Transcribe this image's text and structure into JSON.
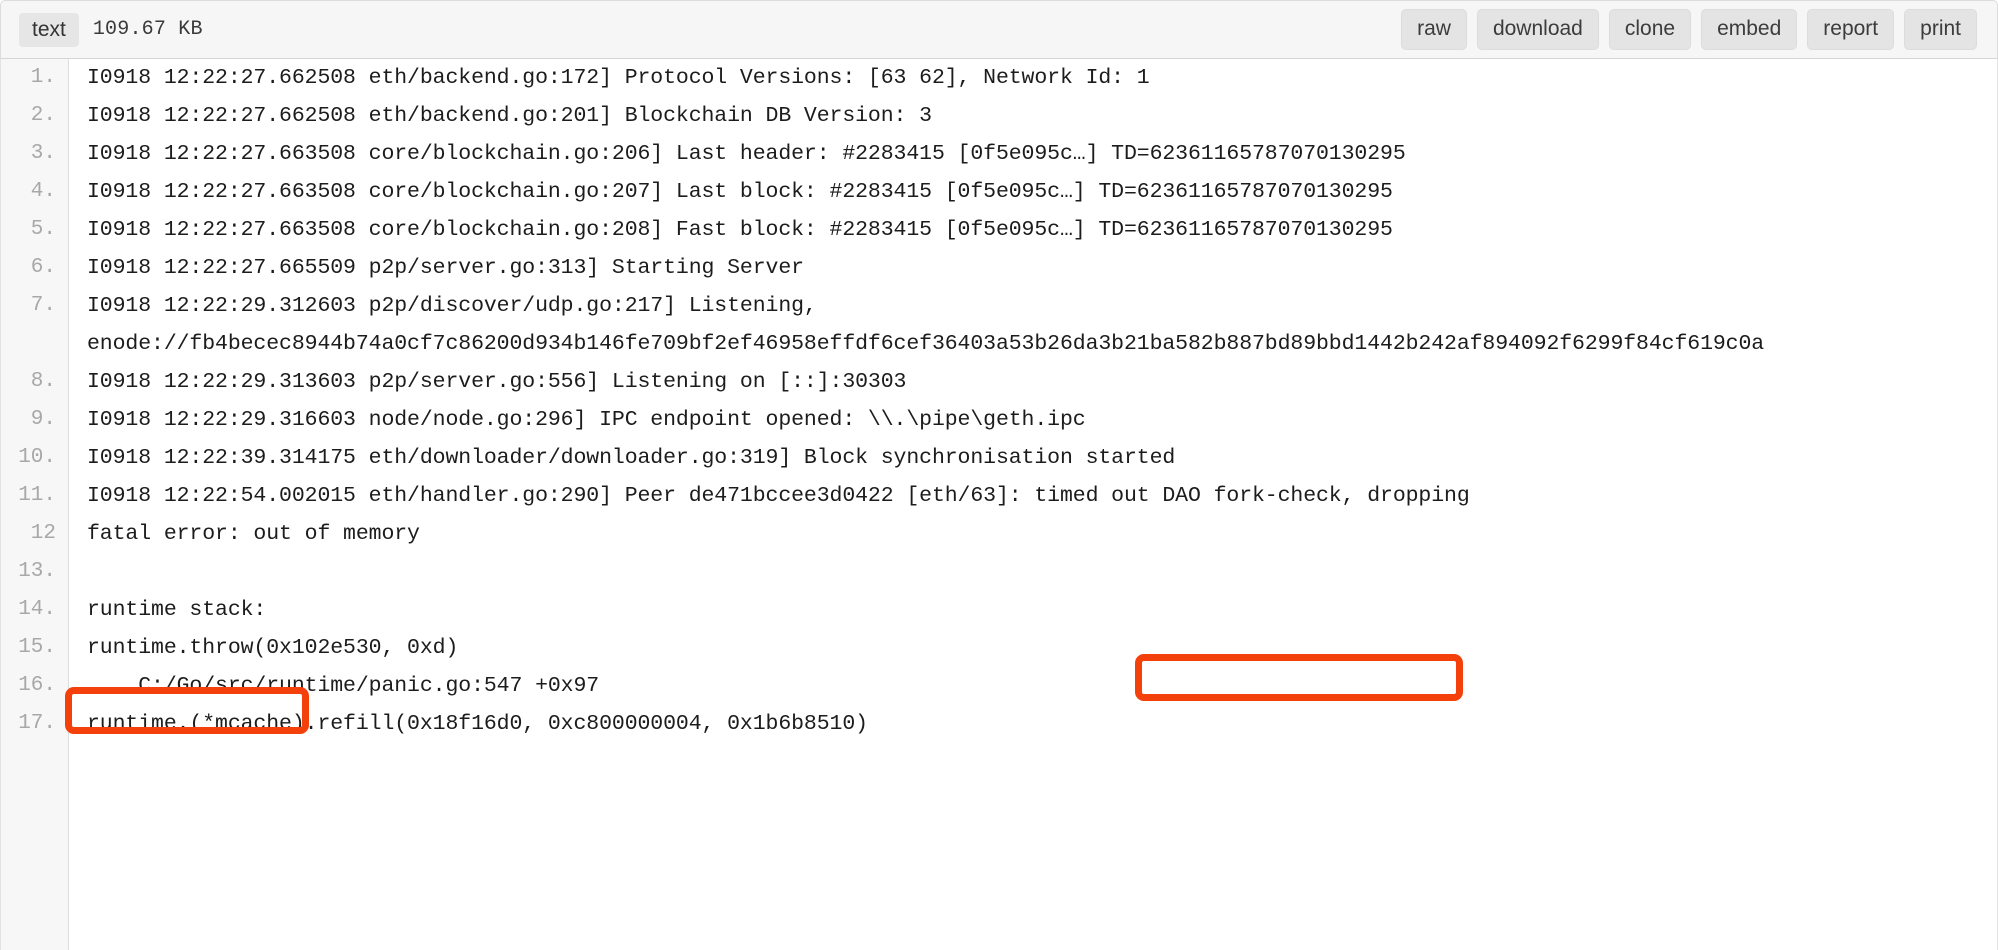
{
  "header": {
    "type_badge": "text",
    "file_size": "109.67 KB",
    "actions": [
      {
        "name": "raw",
        "label": "raw"
      },
      {
        "name": "download",
        "label": "download"
      },
      {
        "name": "clone",
        "label": "clone"
      },
      {
        "name": "embed",
        "label": "embed"
      },
      {
        "name": "report",
        "label": "report"
      },
      {
        "name": "print",
        "label": "print"
      }
    ]
  },
  "accent_color": "#f4410b",
  "code": {
    "lines": [
      {
        "n": "1.",
        "text": "I0918 12:22:27.662508 eth/backend.go:172] Protocol Versions: [63 62], Network Id: 1"
      },
      {
        "n": "2.",
        "text": "I0918 12:22:27.662508 eth/backend.go:201] Blockchain DB Version: 3"
      },
      {
        "n": "3.",
        "text": "I0918 12:22:27.663508 core/blockchain.go:206] Last header: #2283415 [0f5e095c…] TD=62361165787070130295"
      },
      {
        "n": "4.",
        "text": "I0918 12:22:27.663508 core/blockchain.go:207] Last block: #2283415 [0f5e095c…] TD=62361165787070130295"
      },
      {
        "n": "5.",
        "text": "I0918 12:22:27.663508 core/blockchain.go:208] Fast block: #2283415 [0f5e095c…] TD=62361165787070130295"
      },
      {
        "n": "6.",
        "text": "I0918 12:22:27.665509 p2p/server.go:313] Starting Server"
      },
      {
        "n": "7.",
        "text": "I0918 12:22:29.312603 p2p/discover/udp.go:217] Listening,",
        "cont": "enode://fb4becec8944b74a0cf7c86200d934b146fe709bf2ef46958effdf6cef36403a53b26da3b21ba582b887bd89bbd1442b242af894092f6299f84cf619c0a"
      },
      {
        "n": "8.",
        "text": "I0918 12:22:29.313603 p2p/server.go:556] Listening on [::]:30303"
      },
      {
        "n": "9.",
        "text": "I0918 12:22:29.316603 node/node.go:296] IPC endpoint opened: \\\\.\\pipe\\geth.ipc"
      },
      {
        "n": "10.",
        "text": "I0918 12:22:39.314175 eth/downloader/downloader.go:319] Block synchronisation started"
      },
      {
        "n": "11.",
        "text": "I0918 12:22:54.002015 eth/handler.go:290] Peer de471bccee3d0422 [eth/63]: timed out DAO fork-check, dropping"
      },
      {
        "n": "12",
        "text": "fatal error: out of memory"
      },
      {
        "n": "13.",
        "text": ""
      },
      {
        "n": "14.",
        "text": "runtime stack:"
      },
      {
        "n": "15.",
        "text": "runtime.throw(0x102e530, 0xd)"
      },
      {
        "n": "16.",
        "text": "    C:/Go/src/runtime/panic.go:547 +0x97"
      },
      {
        "n": "17.",
        "text": "runtime.(*mcache).refill(0x18f16d0, 0xc800000004, 0x1b6b8510)"
      }
    ]
  },
  "annotations": [
    {
      "name": "annotation-dao-fork-check",
      "target_text": ": timed out DAO fork-check, dropping"
    },
    {
      "name": "annotation-out-of-memory",
      "target_text": "fatal error: out of memory"
    }
  ]
}
